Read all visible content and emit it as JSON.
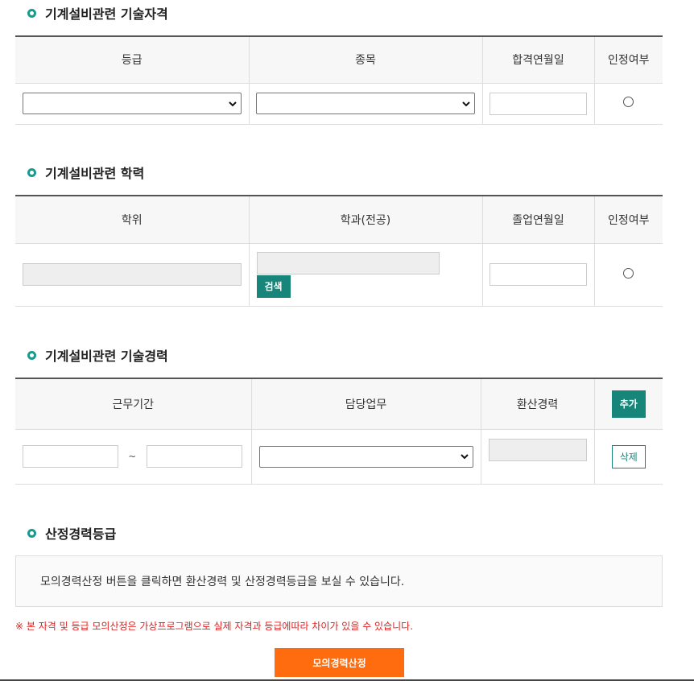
{
  "section1": {
    "title": "기계설비관련 기술자격",
    "headers": [
      "등급",
      "종목",
      "합격연월일",
      "인정여부"
    ]
  },
  "section2": {
    "title": "기계설비관련 학력",
    "headers": [
      "학위",
      "학과(전공)",
      "졸업연월일",
      "인정여부"
    ],
    "search_button": "검색"
  },
  "section3": {
    "title": "기계설비관련 기술경력",
    "headers": [
      "근무기간",
      "담당업무",
      "환산경력"
    ],
    "add_button": "추가",
    "delete_button": "삭제",
    "tilde": "~"
  },
  "section4": {
    "title": "산정경력등급",
    "info_text": "모의경력산정 버튼을 클릭하면 환산경력 및 산정경력등급을 보실 수 있습니다."
  },
  "notice": "※ 본 자격 및 등급 모의산정은 가상프로그램으로 실제 자격과 등급에따라 차이가 있을 수 있습니다.",
  "calculate_button": "모의경력산정",
  "colors": {
    "accent": "#17857a",
    "orange": "#ff6c0f",
    "notice_red": "#e02020"
  }
}
